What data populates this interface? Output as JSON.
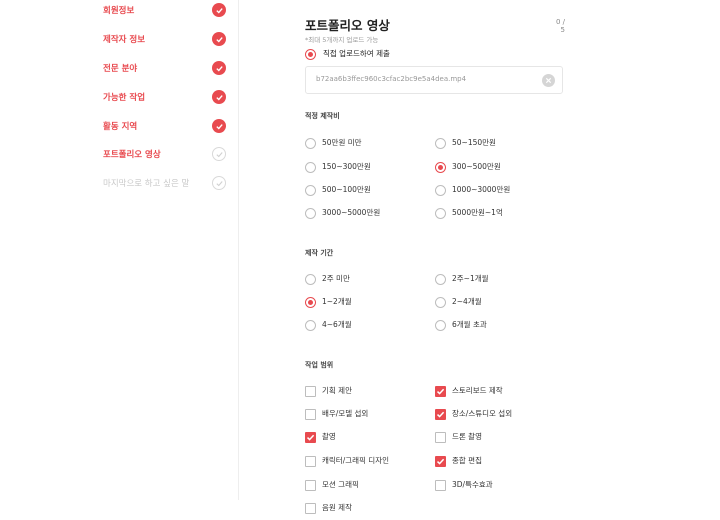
{
  "sidebar": {
    "items": [
      {
        "label": "회원정보",
        "state": "done"
      },
      {
        "label": "제작자 정보",
        "state": "done"
      },
      {
        "label": "전문 분야",
        "state": "done"
      },
      {
        "label": "가능한 작업",
        "state": "done"
      },
      {
        "label": "활동 지역",
        "state": "done"
      },
      {
        "label": "포트폴리오 영상",
        "state": "todo"
      },
      {
        "label": "마지막으로 하고 싶은 말",
        "state": "todo"
      }
    ]
  },
  "portfolio": {
    "title": "포트폴리오 영상",
    "count": "0 / 5",
    "hint": "*최대 5개까지 업로드 가능",
    "upload_option": "직접 업로드하여 제출",
    "file_name": "b72aa6b3ffec960c3cfac2bc9e5a4dea.mp4"
  },
  "budget": {
    "section_label": "적정 제작비",
    "options": [
      "50만원 미만",
      "50~150만원",
      "150~300만원",
      "300~500만원",
      "500~100만원",
      "1000~3000만원",
      "3000~5000만원",
      "5000만원~1억"
    ],
    "selected": "300~500만원"
  },
  "period": {
    "section_label": "제작 기간",
    "options": [
      "2주 미만",
      "2주~1개월",
      "1~2개월",
      "2~4개월",
      "4~6개월",
      "6개월 초과"
    ],
    "selected": "1~2개월"
  },
  "scope": {
    "section_label": "작업 범위",
    "options": [
      {
        "label": "기획 제안",
        "checked": false
      },
      {
        "label": "스토리보드 제작",
        "checked": true
      },
      {
        "label": "배우/모델 섭외",
        "checked": false
      },
      {
        "label": "장소/스튜디오 섭외",
        "checked": true
      },
      {
        "label": "촬영",
        "checked": true
      },
      {
        "label": "드론 촬영",
        "checked": false
      },
      {
        "label": "캐릭터/그래픽 디자인",
        "checked": false
      },
      {
        "label": "종합 편집",
        "checked": true
      },
      {
        "label": "모션 그래픽",
        "checked": false
      },
      {
        "label": "3D/특수효과",
        "checked": false
      },
      {
        "label": "음원 제작",
        "checked": false
      }
    ]
  },
  "colors": {
    "accent": "#e84a4f"
  },
  "icons": {
    "done": "check-circle-icon",
    "todo": "check-outline-icon",
    "clear": "close-circle-icon"
  }
}
